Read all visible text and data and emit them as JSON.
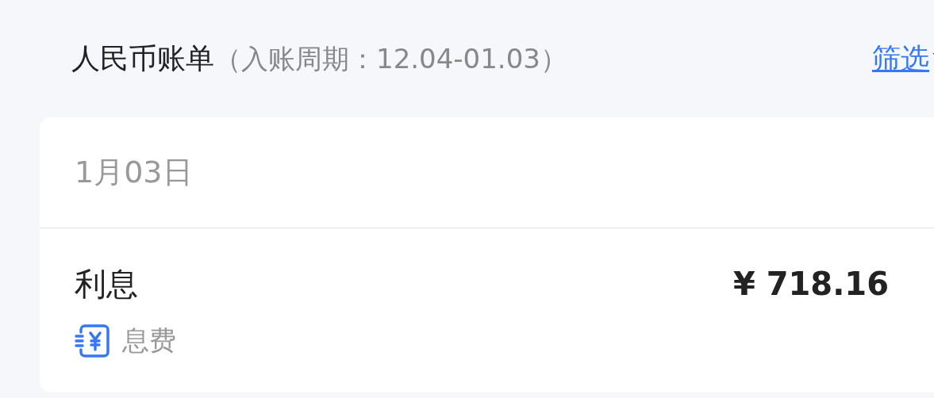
{
  "header": {
    "title": "人民币账单",
    "period": "（入账周期：12.04-01.03）",
    "filter": "筛选"
  },
  "groups": [
    {
      "date": "1月03日",
      "items": [
        {
          "title": "利息",
          "amount": "¥ 718.16",
          "category": "息费"
        }
      ]
    }
  ]
}
